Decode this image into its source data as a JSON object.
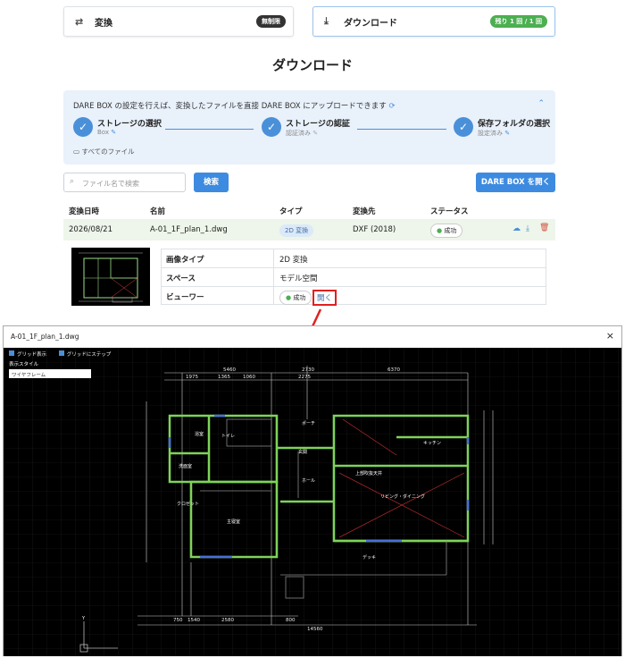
{
  "tabs": [
    {
      "label": "変換",
      "badge": "無制限",
      "icon": "convert-icon"
    },
    {
      "label": "ダウンロード",
      "badge": "残り 1 回 / 1 回",
      "icon": "download-icon"
    }
  ],
  "page_title": "ダウンロード",
  "banner": {
    "message": "DARE BOX の設定を行えば、変換したファイルを直接 DARE BOX にアップロードできます",
    "steps": [
      {
        "label": "ストレージの選択",
        "sub": "Box"
      },
      {
        "label": "ストレージの認証",
        "sub": "認証済み"
      },
      {
        "label": "保存フォルダの選択",
        "sub": "設定済み"
      }
    ],
    "folder": "すべてのファイル"
  },
  "search": {
    "placeholder": "ファイル名で検索",
    "button": "検索"
  },
  "open_button": "DARE BOX を開く",
  "table": {
    "headers": [
      "変換日時",
      "名前",
      "タイプ",
      "変換先",
      "ステータス"
    ],
    "row": {
      "date": "2026/08/21",
      "name": "A-01_1F_plan_1.dwg",
      "type": "2D 変換",
      "target": "DXF (2018)",
      "status": "成功"
    }
  },
  "detail": {
    "rows": [
      {
        "label": "画像タイプ",
        "value": "2D 変換"
      },
      {
        "label": "スペース",
        "value": "モデル空間"
      },
      {
        "label": "ビューワー",
        "value": "成功",
        "link": "開く"
      }
    ]
  },
  "viewer": {
    "title": "A-01_1F_plan_1.dwg",
    "close": "×",
    "grid_show": "グリッド表示",
    "grid_snap": "グリッドにステップ",
    "style_label": "表示スタイル",
    "style_value": "ワイヤフレーム",
    "dims": {
      "top_total": "6370",
      "d5460": "5460",
      "d2730": "2730",
      "d1975": "1975",
      "d1365": "1365",
      "d1060": "1060",
      "d2275": "2275",
      "bottom_total": "14560",
      "d2580": "2580",
      "d750": "750",
      "d1540": "1540",
      "d800": "800"
    },
    "rooms": {
      "porch": "ポーチ",
      "kitchen": "キッチン",
      "entrance": "玄関",
      "hall": "ホール",
      "living": "リビング・ダイニング",
      "bedroom": "主寝室",
      "deck": "デッキ",
      "toilet": "トイレ",
      "washroom": "洗面室",
      "bath": "浴室",
      "closet": "クロゼット",
      "ceiling": "上部吹抜天井"
    },
    "axis_y": "Y"
  },
  "colors": {
    "accent": "#3d8be0",
    "green_badge": "#4caf50",
    "dark_badge": "#333333",
    "success_row": "#eef5ea",
    "red_highlight": "#e02020"
  }
}
